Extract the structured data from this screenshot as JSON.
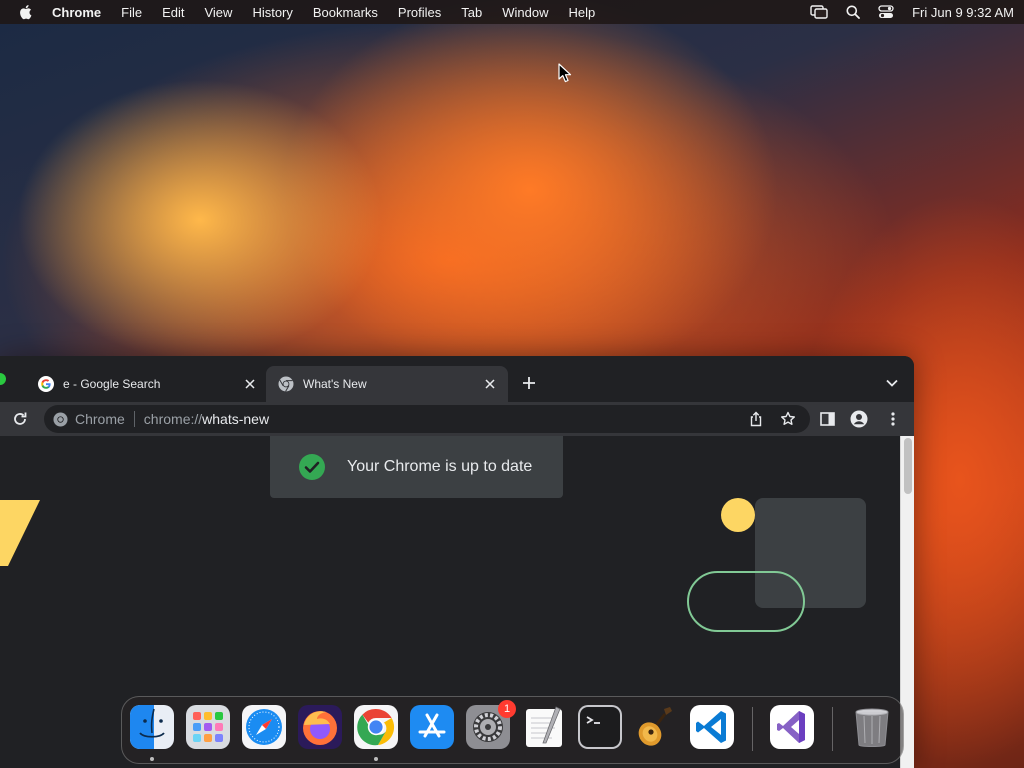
{
  "menubar": {
    "app_name": "Chrome",
    "items": [
      "File",
      "Edit",
      "View",
      "History",
      "Bookmarks",
      "Profiles",
      "Tab",
      "Window",
      "Help"
    ],
    "clock": "Fri Jun 9  9:32 AM"
  },
  "browser": {
    "tabs": [
      {
        "title": "e - Google Search",
        "favicon": "google-icon",
        "active": false
      },
      {
        "title": "What's New",
        "favicon": "chrome-icon",
        "active": true
      }
    ],
    "omnibox": {
      "chip_label": "Chrome",
      "url_scheme": "chrome://",
      "url_host": "whats-new"
    },
    "toast": "Your Chrome is up to date"
  },
  "dock": {
    "apps": [
      "Finder",
      "Launchpad",
      "Safari",
      "Firefox",
      "Google Chrome",
      "App Store",
      "System Settings",
      "TextEdit",
      "Terminal",
      "GarageBand",
      "Visual Studio Code",
      "Visual Studio",
      "Trash"
    ],
    "settings_badge": "1"
  },
  "colors": {
    "accent_green": "#34a853",
    "toast_bg": "#3c4043",
    "window_bg": "#202124"
  }
}
